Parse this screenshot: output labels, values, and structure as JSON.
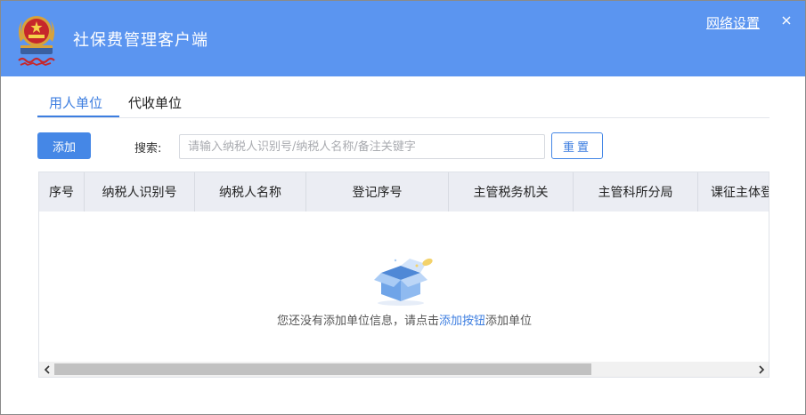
{
  "app": {
    "title": "社保费管理客户端",
    "network_settings_label": "网络设置"
  },
  "tabs": [
    {
      "label": "用人单位",
      "active": true
    },
    {
      "label": "代收单位",
      "active": false
    }
  ],
  "toolbar": {
    "add_label": "添加",
    "search_label": "搜索:",
    "search_placeholder": "请输入纳税人识别号/纳税人名称/备注关键字",
    "search_value": "",
    "reset_label": "重置"
  },
  "table": {
    "columns": [
      "序号",
      "纳税人识别号",
      "纳税人名称",
      "登记序号",
      "主管税务机关",
      "主管科所分局",
      "课征主体登"
    ],
    "rows": []
  },
  "empty_state": {
    "prefix": "您还没有添加单位信息，请点击",
    "link": "添加按钮",
    "suffix": "添加单位"
  },
  "colors": {
    "header_bg": "#5b95f0",
    "accent": "#3d7ee0",
    "table_header_bg": "#ebedf3"
  },
  "icons": {
    "logo": "tax-emblem-icon",
    "close": "close-icon",
    "empty": "empty-box-icon",
    "scroll_left": "chevron-left-icon",
    "scroll_right": "chevron-right-icon"
  }
}
